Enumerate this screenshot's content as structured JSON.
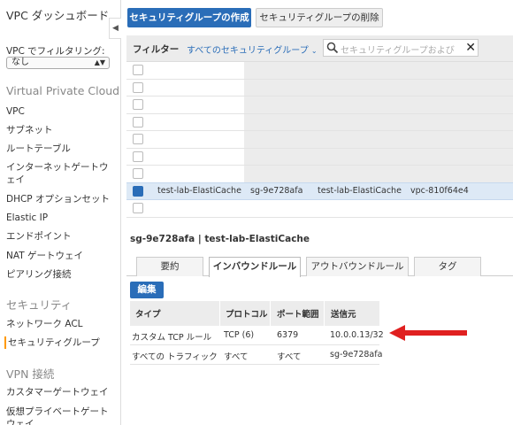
{
  "sidebar": {
    "title": "VPC ダッシュボード",
    "filter_label": "VPC でフィルタリング:",
    "filter_value": "なし",
    "sections": {
      "vpc": "Virtual Private Cloud",
      "security": "セキュリティ",
      "vpn": "VPN 接続"
    },
    "vpc_items": [
      "VPC",
      "サブネット",
      "ルートテーブル",
      "インターネットゲートウェイ",
      "DHCP オプションセット",
      "Elastic IP",
      "エンドポイント",
      "NAT ゲートウェイ",
      "ピアリング接続"
    ],
    "security_items": [
      "ネットワーク ACL",
      "セキュリティグループ"
    ],
    "vpn_items": [
      "カスタマーゲートウェイ",
      "仮想プライベートゲートウェイ"
    ]
  },
  "toolbar": {
    "create_label": "セキュリティグループの作成",
    "delete_label": "セキュリティグループの削除"
  },
  "filter": {
    "label": "フィルター",
    "dropdown": "すべてのセキュリティグループ",
    "search_placeholder": "セキュリティグループおよび"
  },
  "grid": {
    "selected_row": {
      "name": "test-lab-ElastiCache",
      "group_id": "sg-9e728afa",
      "group_name": "test-lab-ElastiCache",
      "vpc_id": "vpc-810f64e4"
    }
  },
  "details": {
    "title": "sg-9e728afa | test-lab-ElastiCache",
    "tabs": [
      "要約",
      "インバウンドルール",
      "アウトバウンドルール",
      "タグ"
    ],
    "edit_label": "編集",
    "table": {
      "headers": [
        "タイプ",
        "プロトコル",
        "ポート範囲",
        "送信元"
      ],
      "rows": [
        [
          "カスタム TCP ルール",
          "TCP (6)",
          "6379",
          "10.0.0.13/32"
        ],
        [
          "すべての トラフィック",
          "すべて",
          "すべて",
          "sg-9e728afa"
        ]
      ]
    }
  },
  "colors": {
    "primary": "#2a6db8",
    "arrow": "#e02020",
    "active_marker": "#ff9900"
  }
}
